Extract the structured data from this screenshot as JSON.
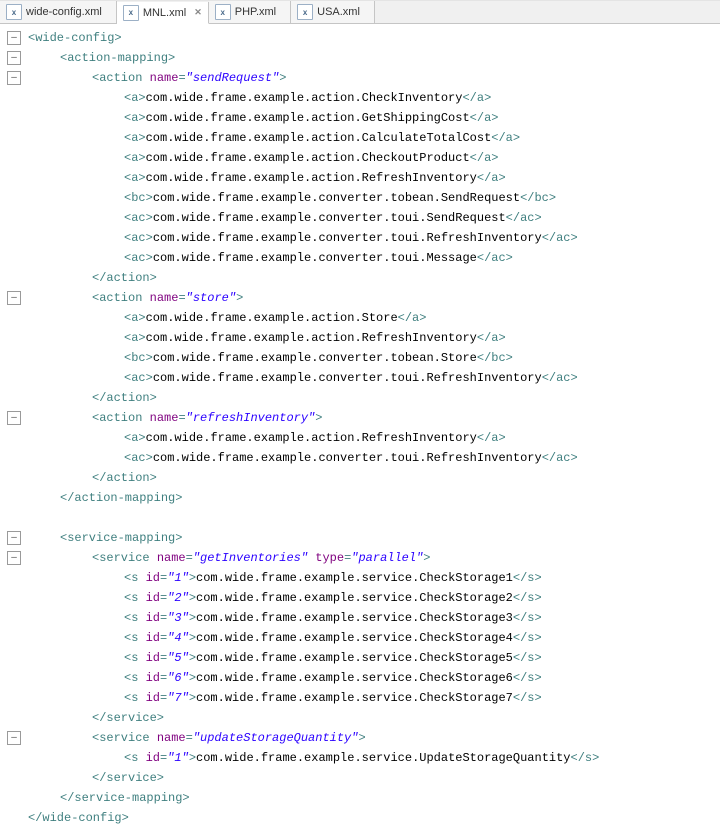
{
  "tabs": [
    {
      "icon": "x",
      "label": "wide-config.xml",
      "active": false,
      "close": ""
    },
    {
      "icon": "x",
      "label": "MNL.xml",
      "active": true,
      "close": "✕"
    },
    {
      "icon": "x",
      "label": "PHP.xml",
      "active": false,
      "close": ""
    },
    {
      "icon": "x",
      "label": "USA.xml",
      "active": false,
      "close": ""
    }
  ],
  "xml": {
    "root": "wide-config",
    "actionMapping": "action-mapping",
    "actionTag": "action",
    "serviceMapping": "service-mapping",
    "serviceTag": "service",
    "nameAttr": "name",
    "typeAttr": "type",
    "idAttr": "id",
    "actions": [
      {
        "name": "sendRequest",
        "children": [
          {
            "tag": "a",
            "text": "com.wide.frame.example.action.CheckInventory"
          },
          {
            "tag": "a",
            "text": "com.wide.frame.example.action.GetShippingCost"
          },
          {
            "tag": "a",
            "text": "com.wide.frame.example.action.CalculateTotalCost"
          },
          {
            "tag": "a",
            "text": "com.wide.frame.example.action.CheckoutProduct"
          },
          {
            "tag": "a",
            "text": "com.wide.frame.example.action.RefreshInventory"
          },
          {
            "tag": "bc",
            "text": "com.wide.frame.example.converter.tobean.SendRequest"
          },
          {
            "tag": "ac",
            "text": "com.wide.frame.example.converter.toui.SendRequest"
          },
          {
            "tag": "ac",
            "text": "com.wide.frame.example.converter.toui.RefreshInventory"
          },
          {
            "tag": "ac",
            "text": "com.wide.frame.example.converter.toui.Message"
          }
        ]
      },
      {
        "name": "store",
        "children": [
          {
            "tag": "a",
            "text": "com.wide.frame.example.action.Store"
          },
          {
            "tag": "a",
            "text": "com.wide.frame.example.action.RefreshInventory"
          },
          {
            "tag": "bc",
            "text": "com.wide.frame.example.converter.tobean.Store"
          },
          {
            "tag": "ac",
            "text": "com.wide.frame.example.converter.toui.RefreshInventory"
          }
        ]
      },
      {
        "name": "refreshInventory",
        "children": [
          {
            "tag": "a",
            "text": "com.wide.frame.example.action.RefreshInventory"
          },
          {
            "tag": "ac",
            "text": "com.wide.frame.example.converter.toui.RefreshInventory"
          }
        ]
      }
    ],
    "services": [
      {
        "name": "getInventories",
        "type": "parallel",
        "children": [
          {
            "id": "1",
            "text": "com.wide.frame.example.service.CheckStorage1"
          },
          {
            "id": "2",
            "text": "com.wide.frame.example.service.CheckStorage2"
          },
          {
            "id": "3",
            "text": "com.wide.frame.example.service.CheckStorage3"
          },
          {
            "id": "4",
            "text": "com.wide.frame.example.service.CheckStorage4"
          },
          {
            "id": "5",
            "text": "com.wide.frame.example.service.CheckStorage5"
          },
          {
            "id": "6",
            "text": "com.wide.frame.example.service.CheckStorage6"
          },
          {
            "id": "7",
            "text": "com.wide.frame.example.service.CheckStorage7"
          }
        ]
      },
      {
        "name": "updateStorageQuantity",
        "type": null,
        "children": [
          {
            "id": "1",
            "text": "com.wide.frame.example.service.UpdateStorageQuantity"
          }
        ]
      }
    ]
  }
}
